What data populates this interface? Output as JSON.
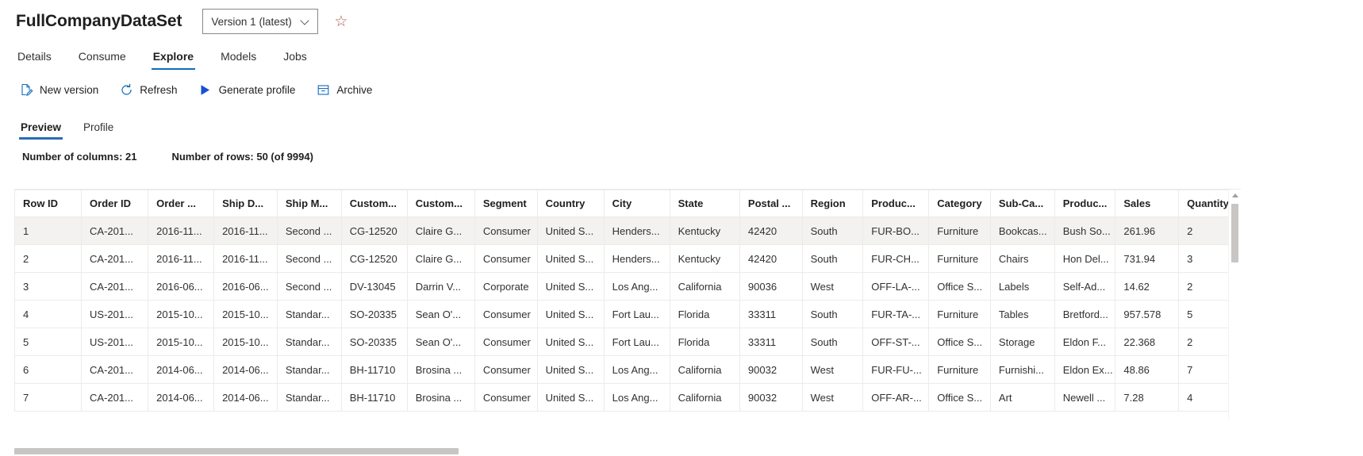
{
  "header": {
    "dataset_title": "FullCompanyDataSet",
    "version_label": "Version 1 (latest)",
    "favorite_icon": "star-icon"
  },
  "tabs": [
    {
      "label": "Details",
      "active": false
    },
    {
      "label": "Consume",
      "active": false
    },
    {
      "label": "Explore",
      "active": true
    },
    {
      "label": "Models",
      "active": false
    },
    {
      "label": "Jobs",
      "active": false
    }
  ],
  "commands": [
    {
      "label": "New version",
      "icon": "new-version-icon"
    },
    {
      "label": "Refresh",
      "icon": "refresh-icon"
    },
    {
      "label": "Generate profile",
      "icon": "play-icon"
    },
    {
      "label": "Archive",
      "icon": "archive-icon"
    }
  ],
  "subtabs": [
    {
      "label": "Preview",
      "active": true
    },
    {
      "label": "Profile",
      "active": false
    }
  ],
  "stats": {
    "columns": "Number of columns: 21",
    "rows": "Number of rows: 50 (of 9994)"
  },
  "accent_color": "#0f6cbd",
  "table": {
    "columns": [
      "Row ID",
      "Order ID",
      "Order ...",
      "Ship D...",
      "Ship M...",
      "Custom...",
      "Custom...",
      "Segment",
      "Country",
      "City",
      "State",
      "Postal ...",
      "Region",
      "Produc...",
      "Category",
      "Sub-Ca...",
      "Produc...",
      "Sales",
      "Quantity"
    ],
    "rows": [
      [
        "1",
        "CA-201...",
        "2016-11...",
        "2016-11...",
        "Second ...",
        "CG-12520",
        "Claire G...",
        "Consumer",
        "United S...",
        "Henders...",
        "Kentucky",
        "42420",
        "South",
        "FUR-BO...",
        "Furniture",
        "Bookcas...",
        "Bush So...",
        "261.96",
        "2"
      ],
      [
        "2",
        "CA-201...",
        "2016-11...",
        "2016-11...",
        "Second ...",
        "CG-12520",
        "Claire G...",
        "Consumer",
        "United S...",
        "Henders...",
        "Kentucky",
        "42420",
        "South",
        "FUR-CH...",
        "Furniture",
        "Chairs",
        "Hon Del...",
        "731.94",
        "3"
      ],
      [
        "3",
        "CA-201...",
        "2016-06...",
        "2016-06...",
        "Second ...",
        "DV-13045",
        "Darrin V...",
        "Corporate",
        "United S...",
        "Los Ang...",
        "California",
        "90036",
        "West",
        "OFF-LA-...",
        "Office S...",
        "Labels",
        "Self-Ad...",
        "14.62",
        "2"
      ],
      [
        "4",
        "US-201...",
        "2015-10...",
        "2015-10...",
        "Standar...",
        "SO-20335",
        "Sean O'...",
        "Consumer",
        "United S...",
        "Fort Lau...",
        "Florida",
        "33311",
        "South",
        "FUR-TA-...",
        "Furniture",
        "Tables",
        "Bretford...",
        "957.578",
        "5"
      ],
      [
        "5",
        "US-201...",
        "2015-10...",
        "2015-10...",
        "Standar...",
        "SO-20335",
        "Sean O'...",
        "Consumer",
        "United S...",
        "Fort Lau...",
        "Florida",
        "33311",
        "South",
        "OFF-ST-...",
        "Office S...",
        "Storage",
        "Eldon F...",
        "22.368",
        "2"
      ],
      [
        "6",
        "CA-201...",
        "2014-06...",
        "2014-06...",
        "Standar...",
        "BH-11710",
        "Brosina ...",
        "Consumer",
        "United S...",
        "Los Ang...",
        "California",
        "90032",
        "West",
        "FUR-FU-...",
        "Furniture",
        "Furnishi...",
        "Eldon Ex...",
        "48.86",
        "7"
      ],
      [
        "7",
        "CA-201...",
        "2014-06...",
        "2014-06...",
        "Standar...",
        "BH-11710",
        "Brosina ...",
        "Consumer",
        "United S...",
        "Los Ang...",
        "California",
        "90032",
        "West",
        "OFF-AR-...",
        "Office S...",
        "Art",
        "Newell ...",
        "7.28",
        "4"
      ]
    ],
    "selected_row_index": 0
  }
}
